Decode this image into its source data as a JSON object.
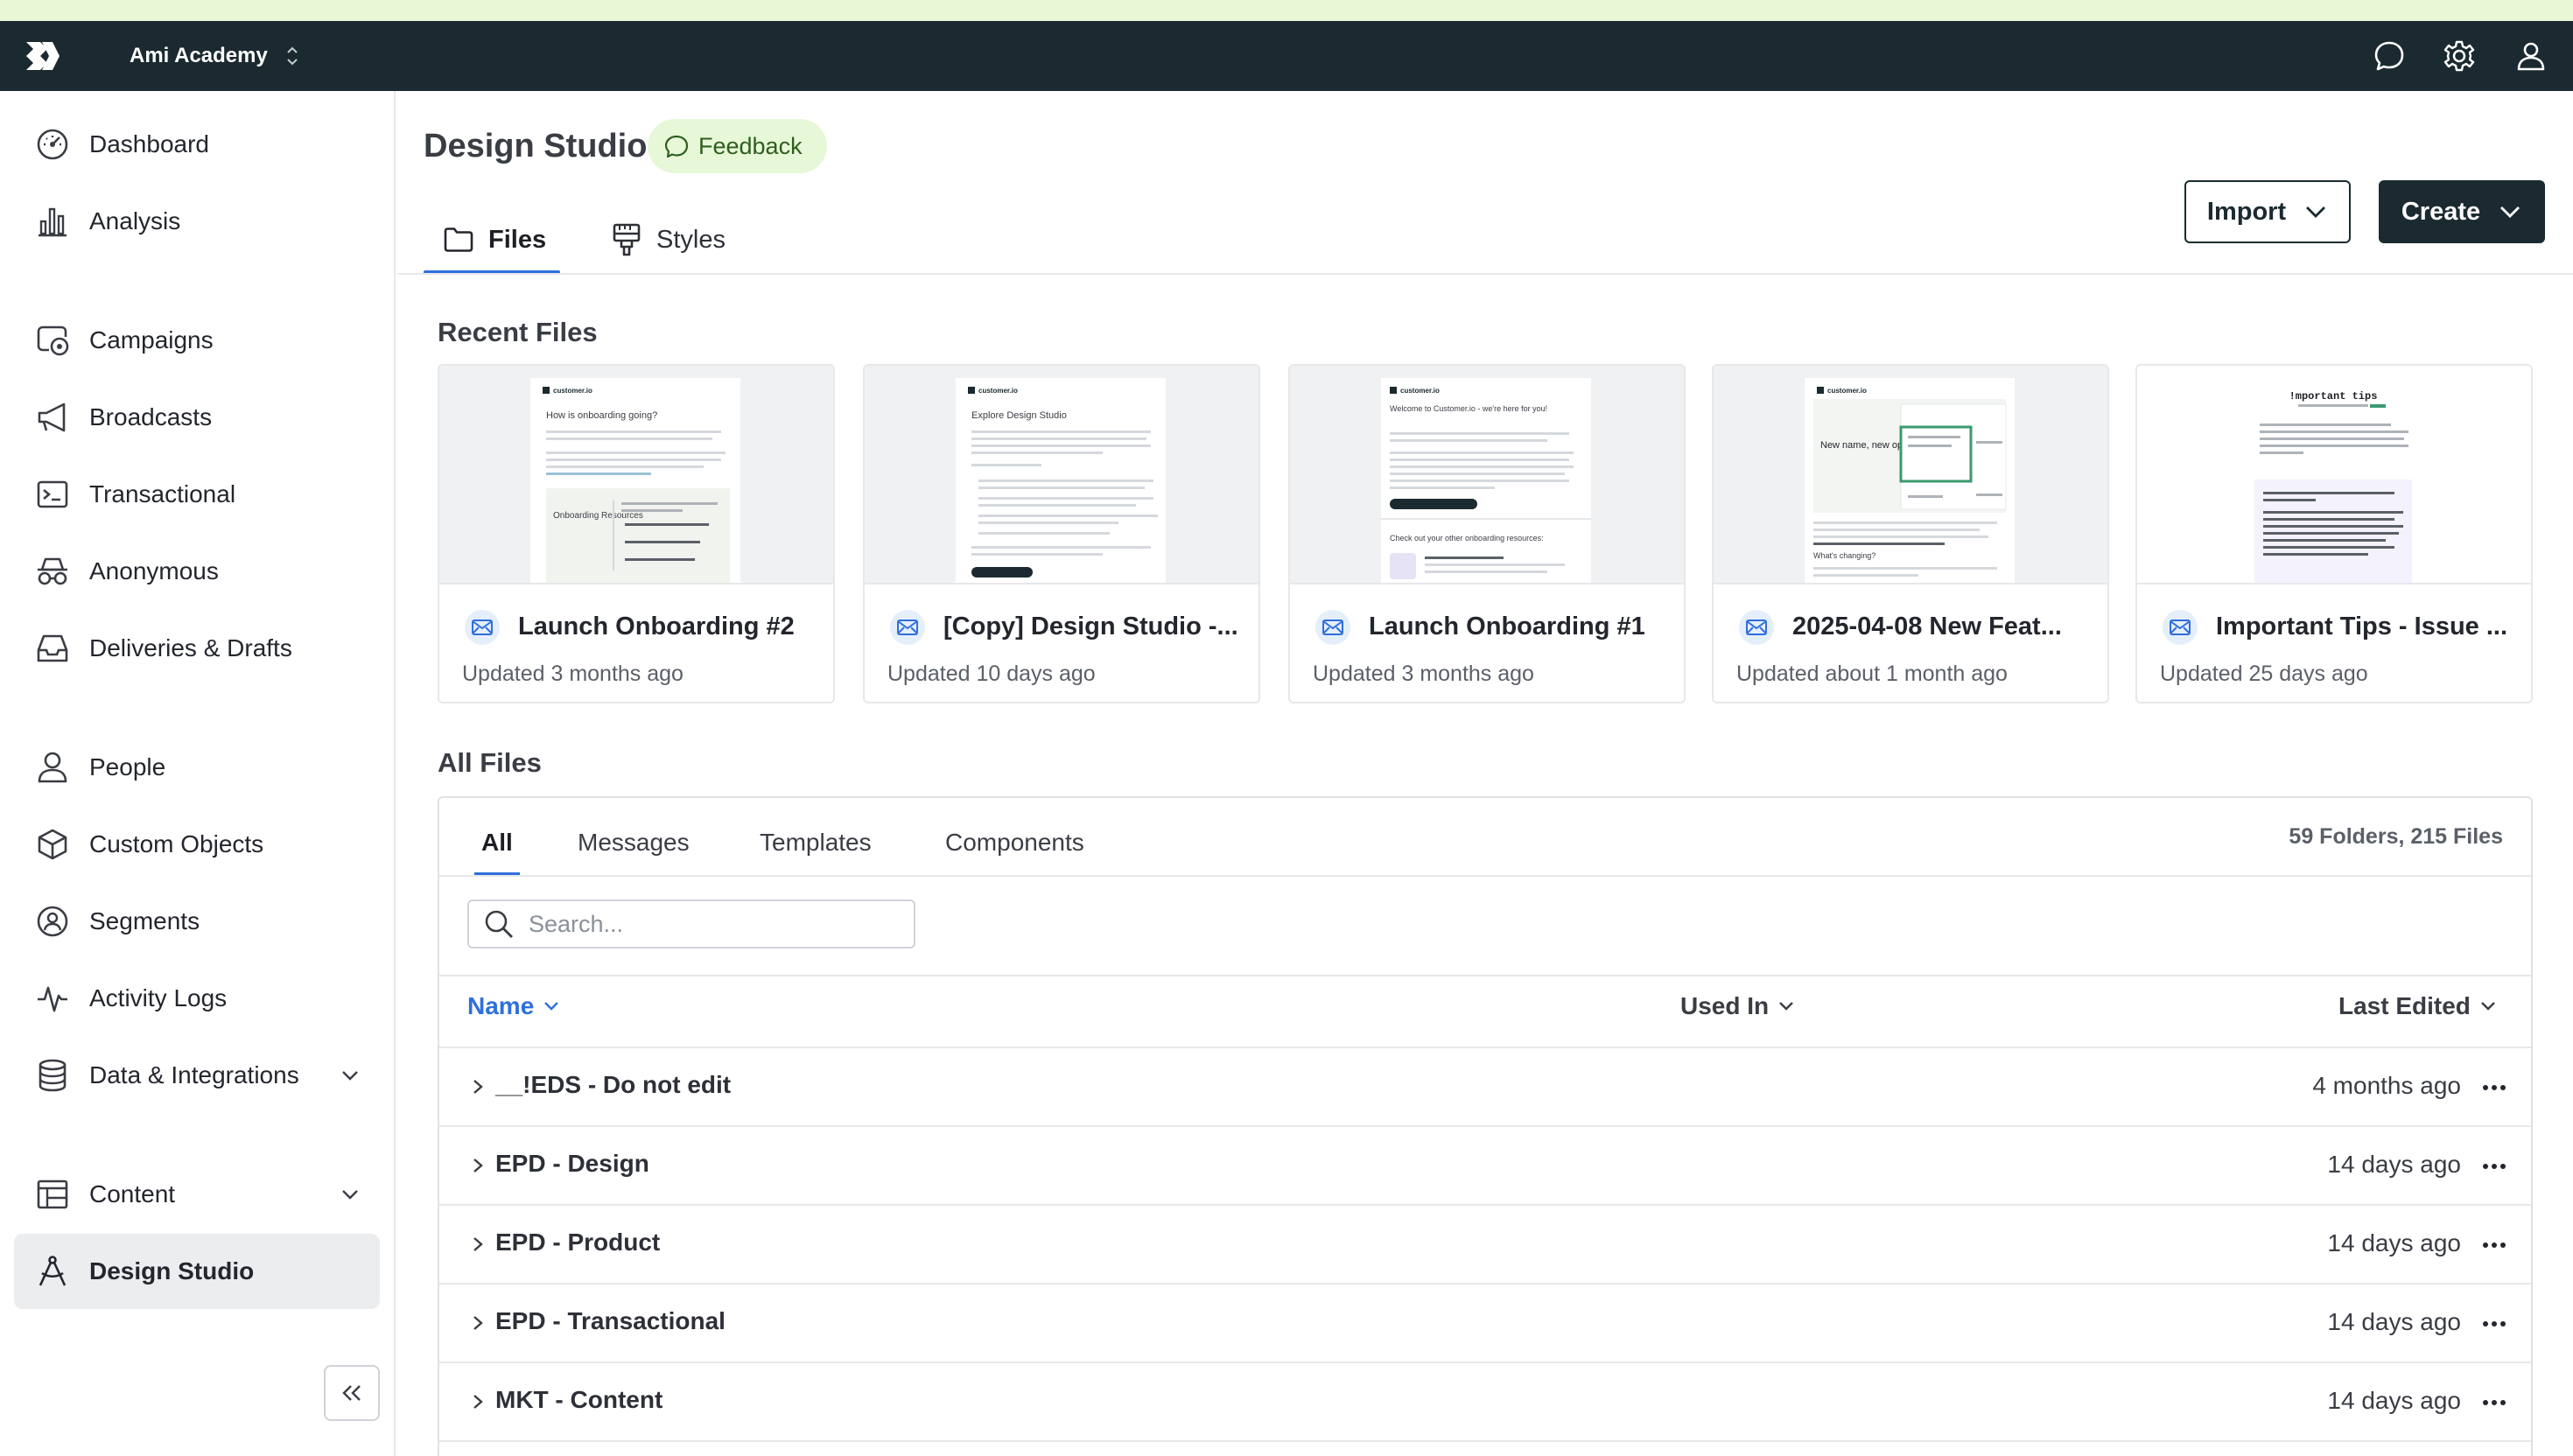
{
  "topbar": {
    "workspace_name": "Ami Academy"
  },
  "sidebar": {
    "items": [
      {
        "label": "Dashboard"
      },
      {
        "label": "Analysis"
      },
      {
        "label": "Campaigns"
      },
      {
        "label": "Broadcasts"
      },
      {
        "label": "Transactional"
      },
      {
        "label": "Anonymous"
      },
      {
        "label": "Deliveries & Drafts"
      },
      {
        "label": "People"
      },
      {
        "label": "Custom Objects"
      },
      {
        "label": "Segments"
      },
      {
        "label": "Activity Logs"
      },
      {
        "label": "Data & Integrations"
      },
      {
        "label": "Content"
      },
      {
        "label": "Design Studio"
      }
    ]
  },
  "header": {
    "title": "Design Studio",
    "feedback_label": "Feedback",
    "tabs": [
      {
        "label": "Files"
      },
      {
        "label": "Styles"
      }
    ],
    "import_label": "Import",
    "create_label": "Create"
  },
  "recent": {
    "title": "Recent Files",
    "cards": [
      {
        "title": "Launch Onboarding #2",
        "updated": "Updated 3 months ago"
      },
      {
        "title": "[Copy] Design Studio -...",
        "updated": "Updated 10 days ago"
      },
      {
        "title": "Launch Onboarding #1",
        "updated": "Updated 3 months ago"
      },
      {
        "title": "2025-04-08 New Feat...",
        "updated": "Updated about 1 month ago"
      },
      {
        "title": "Important Tips - Issue ...",
        "updated": "Updated 25 days ago"
      }
    ]
  },
  "thumbs": {
    "brand": "customer.io",
    "t1_heading": "How is onboarding going?",
    "t1_side": "Onboarding Resources",
    "t2_heading": "Explore Design Studio",
    "t3_heading": "Welcome to Customer.io - we're here for you!",
    "t3_sub": "Check out your other onboarding resources:",
    "t4_heading": "New name, new options",
    "t4_sub": "What's changing?",
    "t5_heading": "!mportant tips"
  },
  "all_files": {
    "title": "All Files",
    "tabs": [
      {
        "label": "All"
      },
      {
        "label": "Messages"
      },
      {
        "label": "Templates"
      },
      {
        "label": "Components"
      }
    ],
    "count": "59 Folders, 215 Files",
    "search_placeholder": "Search...",
    "columns": {
      "name": "Name",
      "used_in": "Used In",
      "last_edited": "Last Edited"
    },
    "rows": [
      {
        "name": "__!EDS - Do not edit",
        "edited": "4 months ago"
      },
      {
        "name": "EPD - Design",
        "edited": "14 days ago"
      },
      {
        "name": "EPD - Product",
        "edited": "14 days ago"
      },
      {
        "name": "EPD - Transactional",
        "edited": "14 days ago"
      },
      {
        "name": "MKT - Content",
        "edited": "14 days ago"
      }
    ]
  },
  "colors": {
    "topbar_bg": "#1b2a30",
    "accent_blue": "#2f6fdd",
    "feedback_bg": "#e7f8d8",
    "active_nav_bg": "#ebedef"
  }
}
